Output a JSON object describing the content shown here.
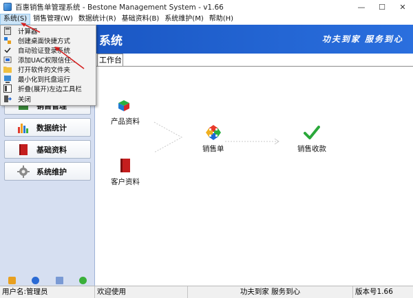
{
  "window": {
    "title": "百惠销售单管理系统 - Bestone Management System - v1.66",
    "minimize": "—",
    "maximize": "☐",
    "close": "✕"
  },
  "menubar": {
    "items": [
      "系统(S)",
      "销售管理(W)",
      "数据统计(R)",
      "基础资料(B)",
      "系统维护(M)",
      "帮助(H)"
    ]
  },
  "banner": {
    "title": "系统",
    "slogan": "功夫到家 服务到心"
  },
  "system_menu": {
    "items": [
      {
        "label": "计算器",
        "icon": "calculator-icon"
      },
      {
        "label": "创建桌面快捷方式",
        "icon": "shortcut-icon"
      },
      {
        "label": "自动验证登录系统",
        "icon": "check-icon"
      },
      {
        "label": "添加UAC权限信任..",
        "icon": "uac-shield-icon"
      },
      {
        "label": "打开软件的文件夹",
        "icon": "folder-icon"
      },
      {
        "label": "最小化到托盘运行",
        "icon": "tray-icon"
      },
      {
        "label": "折叠(展开)左边工具栏",
        "icon": "toolbar-icon"
      },
      {
        "label": "关闭",
        "icon": "exit-icon"
      }
    ]
  },
  "sidebar": {
    "items": [
      {
        "label": "销售管理",
        "icon": "sales-icon"
      },
      {
        "label": "数据统计",
        "icon": "chart-icon"
      },
      {
        "label": "基础资料",
        "icon": "book-icon"
      },
      {
        "label": "系统维护",
        "icon": "gear-icon"
      }
    ]
  },
  "workspace": {
    "tab": "工作台",
    "nodes": {
      "product": "产品资料",
      "customer": "客户资料",
      "sales_order": "销售单",
      "receipt": "销售收款"
    }
  },
  "statusbar": {
    "user": "用户名:管理员",
    "welcome": "欢迎使用",
    "slogan": "功夫到家 服务到心",
    "version": "版本号1.66"
  },
  "colors": {
    "banner_blue": "#1a57c4",
    "sidebar_bg": "#d6dff1",
    "annotation_red": "#d42020"
  }
}
